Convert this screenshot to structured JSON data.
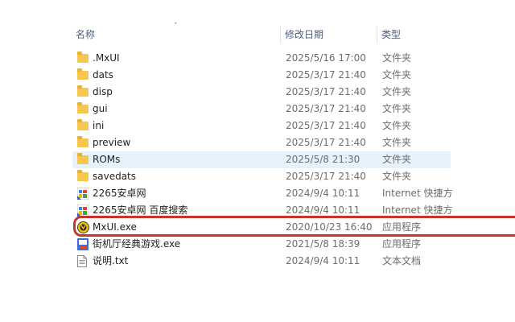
{
  "header": {
    "name_label": "名称",
    "date_label": "修改日期",
    "type_label": "类型",
    "sort_indicator": "ˇ"
  },
  "files": [
    {
      "name": ".MxUI",
      "date": "2025/5/16 17:00",
      "type": "文件夹",
      "icon": "folder-icon"
    },
    {
      "name": "dats",
      "date": "2025/3/17 21:40",
      "type": "文件夹",
      "icon": "folder-icon"
    },
    {
      "name": "disp",
      "date": "2025/3/17 21:40",
      "type": "文件夹",
      "icon": "folder-icon"
    },
    {
      "name": "gui",
      "date": "2025/3/17 21:40",
      "type": "文件夹",
      "icon": "folder-icon"
    },
    {
      "name": "ini",
      "date": "2025/3/17 21:40",
      "type": "文件夹",
      "icon": "folder-icon"
    },
    {
      "name": "preview",
      "date": "2025/3/17 21:40",
      "type": "文件夹",
      "icon": "folder-icon"
    },
    {
      "name": "ROMs",
      "date": "2025/5/8 21:30",
      "type": "文件夹",
      "icon": "folder-icon",
      "selected": true
    },
    {
      "name": "savedats",
      "date": "2025/3/17 21:40",
      "type": "文件夹",
      "icon": "folder-icon"
    },
    {
      "name": "2265安卓网",
      "date": "2024/9/4 10:11",
      "type": "Internet 快捷方",
      "icon": "internet-shortcut-icon"
    },
    {
      "name": "2265安卓网 百度搜索",
      "date": "2024/9/4 10:11",
      "type": "Internet 快捷方",
      "icon": "internet-shortcut-icon"
    },
    {
      "name": "MxUI.exe",
      "date": "2020/10/23 16:40",
      "type": "应用程序",
      "icon": "mxui-app-icon",
      "highlighted": true
    },
    {
      "name": "街机厅经典游戏.exe",
      "date": "2021/5/8 18:39",
      "type": "应用程序",
      "icon": "arcade-app-icon"
    },
    {
      "name": "说明.txt",
      "date": "2024/9/4 10:11",
      "type": "文本文档",
      "icon": "text-document-icon"
    }
  ],
  "colors": {
    "folder": "#f6c650",
    "selection": "#e5f1fb",
    "highlight_border": "#c8352a"
  }
}
